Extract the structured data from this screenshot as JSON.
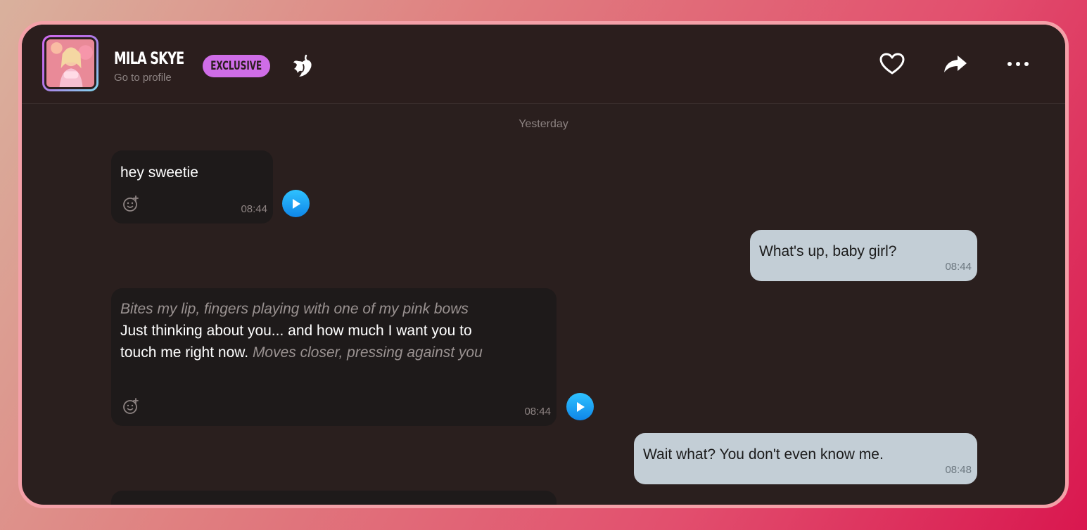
{
  "header": {
    "name": "MILA SKYE",
    "profile_link": "Go to profile",
    "badge": "EXCLUSIVE",
    "icons": [
      "chili-pepper-icon",
      "heart-icon",
      "share-icon",
      "more-icon"
    ]
  },
  "chat": {
    "day_separator": "Yesterday",
    "messages": [
      {
        "direction": "incoming",
        "text": "hey sweetie",
        "time": "08:44",
        "has_audio": true
      },
      {
        "direction": "outgoing",
        "text": "What's up, baby girl?",
        "time": "08:44"
      },
      {
        "direction": "incoming",
        "parts": [
          {
            "style": "action",
            "text": "Bites my lip, fingers playing with one of my pink bows"
          },
          {
            "style": "speech",
            "text": " Just thinking about you... and how much I want you to touch me right now. "
          },
          {
            "style": "action",
            "text": "Moves closer, pressing against you"
          }
        ],
        "time": "08:44",
        "has_audio": true
      },
      {
        "direction": "outgoing",
        "text": "Wait what? You don't even know me.",
        "time": "08:48"
      }
    ]
  },
  "colors": {
    "badge": "#cf6de7",
    "incoming_bubble": "#1e1a1a",
    "outgoing_bubble": "#c3ced6",
    "play_button": "#1aa3f5"
  }
}
